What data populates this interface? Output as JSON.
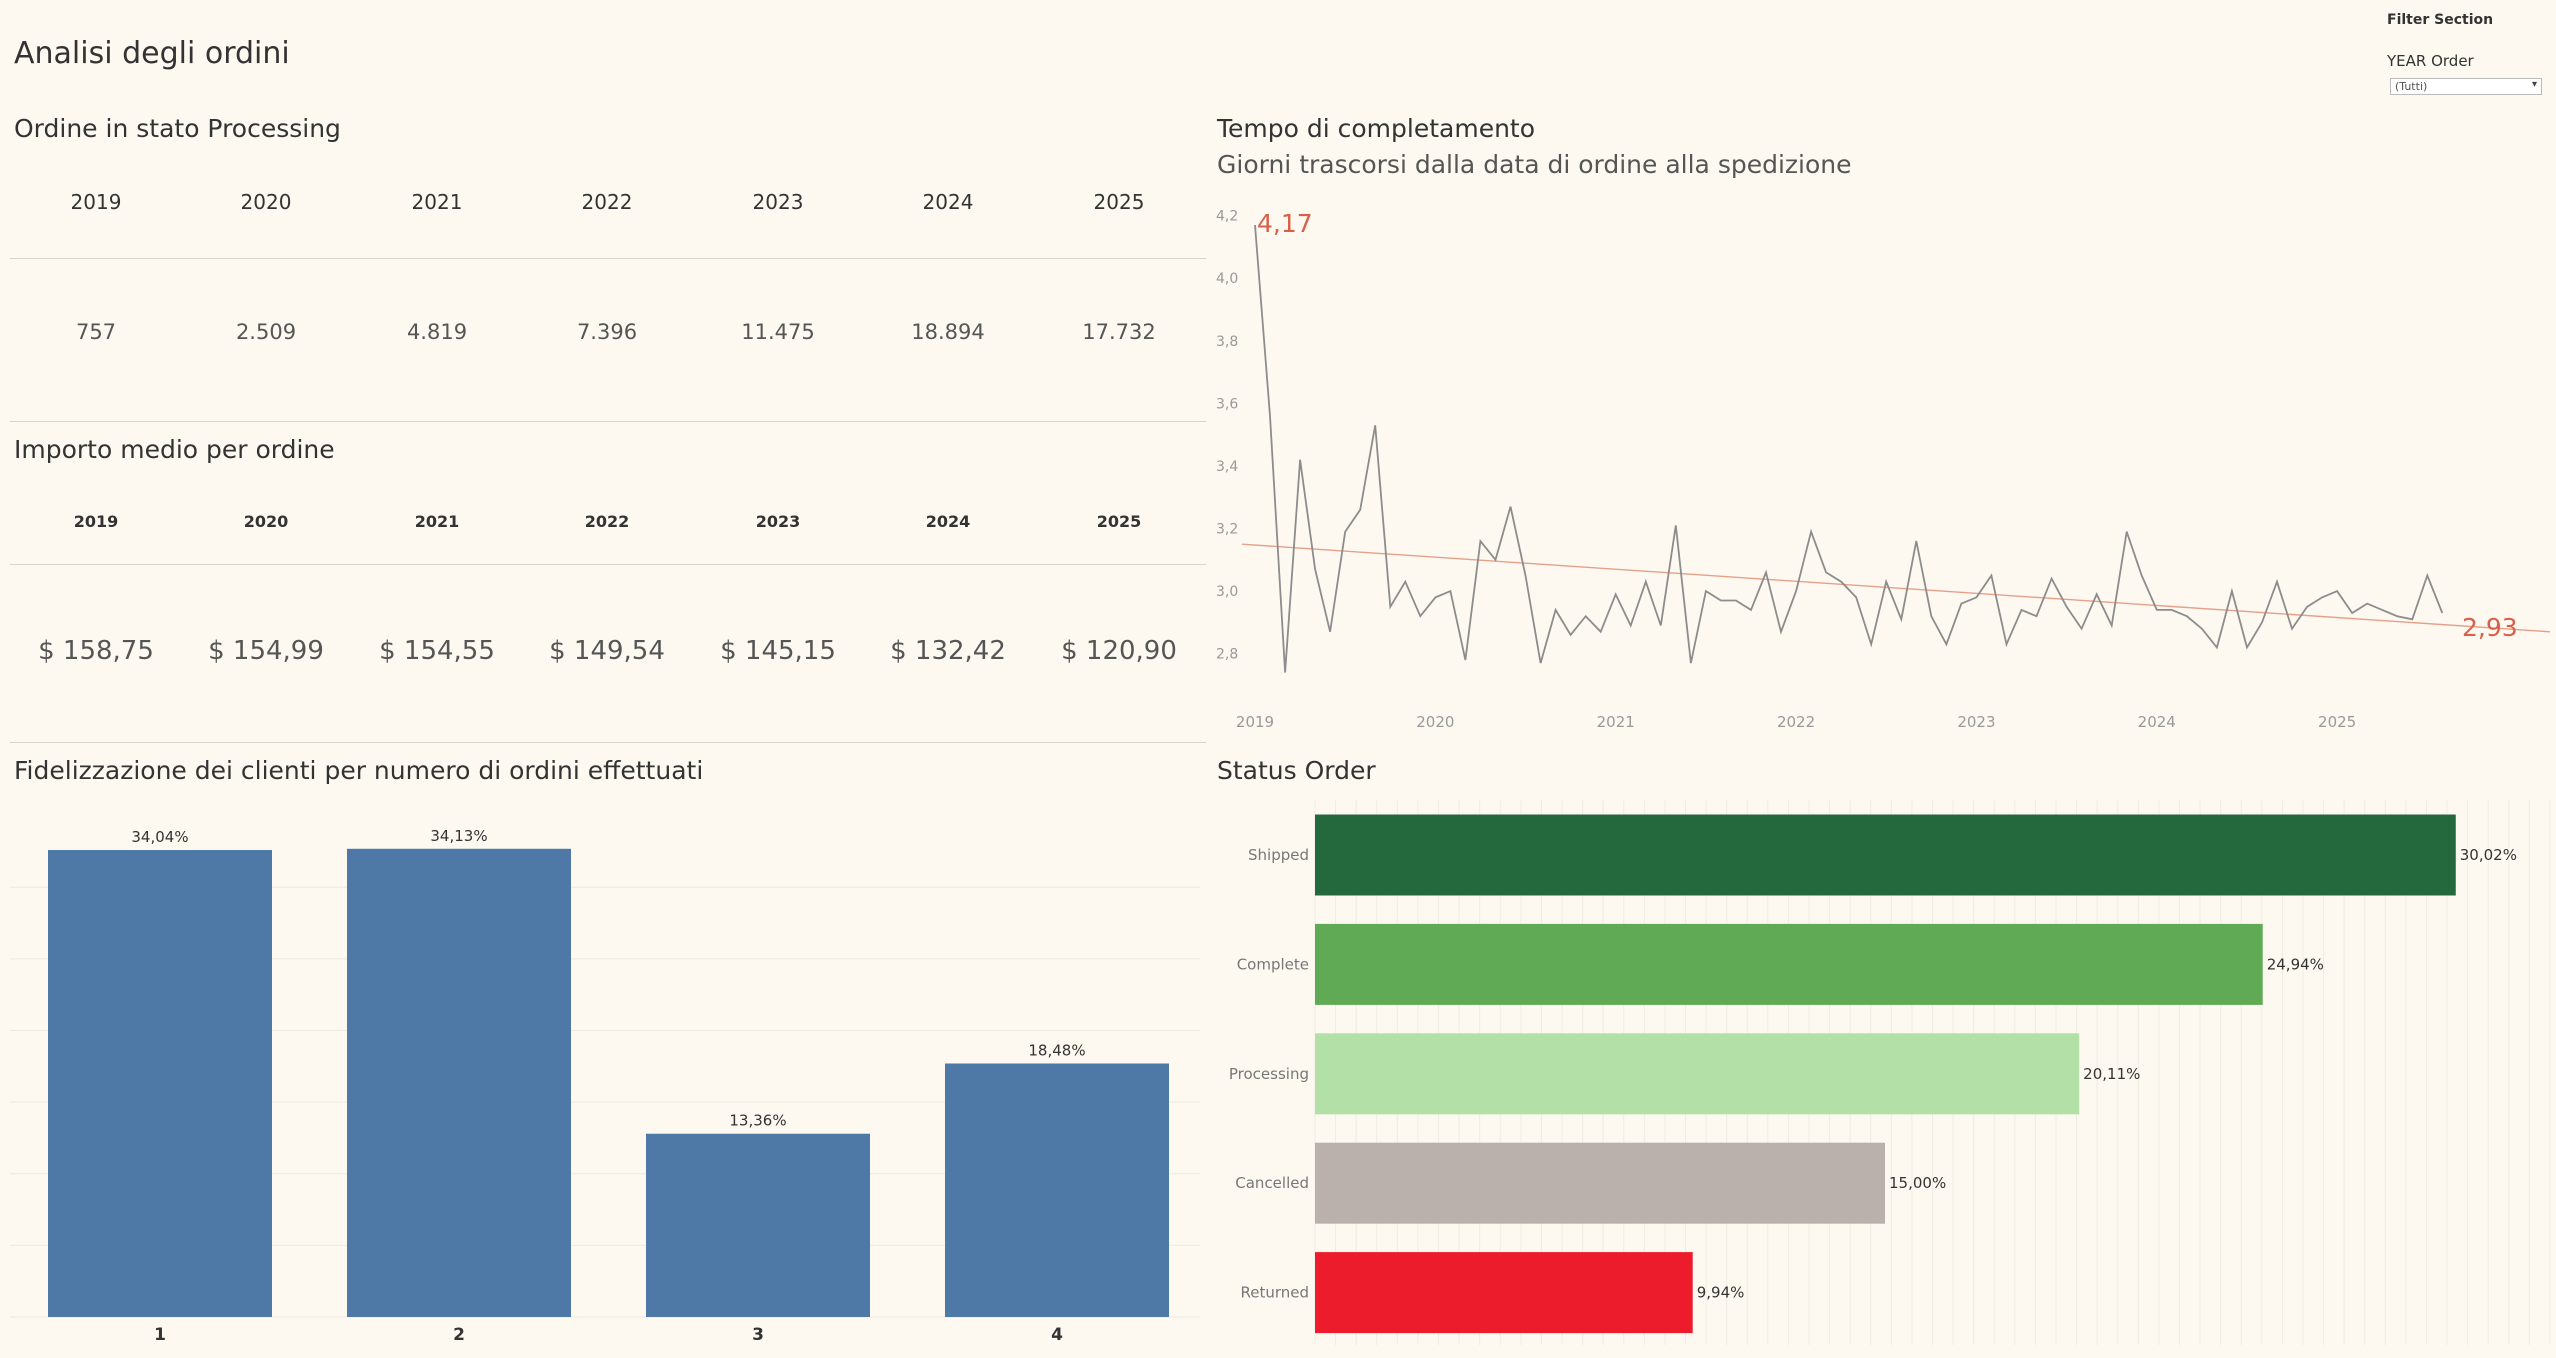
{
  "dashboard": {
    "title": "Analisi degli ordini"
  },
  "filter": {
    "section_title": "Filter Section",
    "label": "YEAR Order",
    "value": "(Tutti)"
  },
  "processing": {
    "title": "Ordine in stato Processing",
    "years": [
      "2019",
      "2020",
      "2021",
      "2022",
      "2023",
      "2024",
      "2025"
    ],
    "values": [
      "757",
      "2.509",
      "4.819",
      "7.396",
      "11.475",
      "18.894",
      "17.732"
    ]
  },
  "avg_amount": {
    "title": "Importo medio per ordine",
    "years": [
      "2019",
      "2020",
      "2021",
      "2022",
      "2023",
      "2024",
      "2025"
    ],
    "values": [
      "$ 158,75",
      "$ 154,99",
      "$ 154,55",
      "$ 149,54",
      "$ 145,15",
      "$ 132,42",
      "$ 120,90"
    ]
  },
  "completion": {
    "title": "Tempo di completamento",
    "subtitle": "Giorni trascorsi dalla data di ordine alla spedizione"
  },
  "loyalty": {
    "title": "Fidelizzazione dei clienti per numero di ordini effettuati"
  },
  "status": {
    "title": "Status Order"
  },
  "chart_data": [
    {
      "id": "completion_time",
      "type": "line",
      "title": "Tempo di completamento",
      "subtitle": "Giorni trascorsi dalla data di ordine alla spedizione",
      "x_tick_labels": [
        "2019",
        "2020",
        "2021",
        "2022",
        "2023",
        "2024",
        "2025"
      ],
      "y_tick_labels": [
        "2,8",
        "3,0",
        "3,2",
        "3,4",
        "3,6",
        "3,8",
        "4,0",
        "4,2"
      ],
      "ylim": [
        2.7,
        4.25
      ],
      "x_start": "2019-01",
      "x_end": "2025-07",
      "values": [
        4.17,
        3.56,
        2.74,
        3.42,
        3.07,
        2.87,
        3.19,
        3.26,
        3.53,
        2.95,
        3.03,
        2.92,
        2.98,
        3.0,
        2.78,
        3.16,
        3.1,
        3.27,
        3.05,
        2.77,
        2.94,
        2.86,
        2.92,
        2.87,
        2.99,
        2.89,
        3.03,
        2.89,
        3.21,
        2.77,
        3.0,
        2.97,
        2.97,
        2.94,
        3.06,
        2.87,
        3.0,
        3.19,
        3.06,
        3.03,
        2.98,
        2.83,
        3.03,
        2.91,
        3.16,
        2.92,
        2.83,
        2.96,
        2.98,
        3.05,
        2.83,
        2.94,
        2.92,
        3.04,
        2.95,
        2.88,
        2.99,
        2.89,
        3.19,
        3.05,
        2.94,
        2.94,
        2.92,
        2.88,
        2.82,
        3.0,
        2.82,
        2.9,
        3.03,
        2.88,
        2.95,
        2.98,
        3.0,
        2.93,
        2.96,
        2.94,
        2.92,
        2.91,
        3.05,
        2.93
      ],
      "trend": {
        "start": 3.15,
        "end": 2.87
      },
      "annotations": [
        {
          "label": "4,17",
          "value": 4.17
        },
        {
          "label": "2,93",
          "value": 2.93
        }
      ],
      "colors": {
        "line": "#8c8c8c",
        "trend": "#e6a08a",
        "annotation": "#d9604a"
      }
    },
    {
      "id": "customer_loyalty",
      "type": "bar",
      "title": "Fidelizzazione dei clienti per numero di ordini effettuati",
      "categories": [
        "1",
        "2",
        "3",
        "4"
      ],
      "values": [
        34.04,
        34.13,
        13.36,
        18.48
      ],
      "labels": [
        "34,04%",
        "34,13%",
        "13,36%",
        "18,48%"
      ],
      "ylim": [
        0,
        35.5
      ],
      "color": "#4e79a7"
    },
    {
      "id": "status_order",
      "type": "bar",
      "orientation": "horizontal",
      "title": "Status Order",
      "categories": [
        "Shipped",
        "Complete",
        "Processing",
        "Cancelled",
        "Returned"
      ],
      "values": [
        30.02,
        24.94,
        20.11,
        15.0,
        9.94
      ],
      "labels": [
        "30,02%",
        "24,94%",
        "20,11%",
        "15,00%",
        "9,94%"
      ],
      "xlim": [
        0,
        32.5
      ],
      "colors": [
        "#24693d",
        "#60aa56",
        "#b3e0a6",
        "#bab0ac",
        "#ec1c2c"
      ]
    }
  ]
}
